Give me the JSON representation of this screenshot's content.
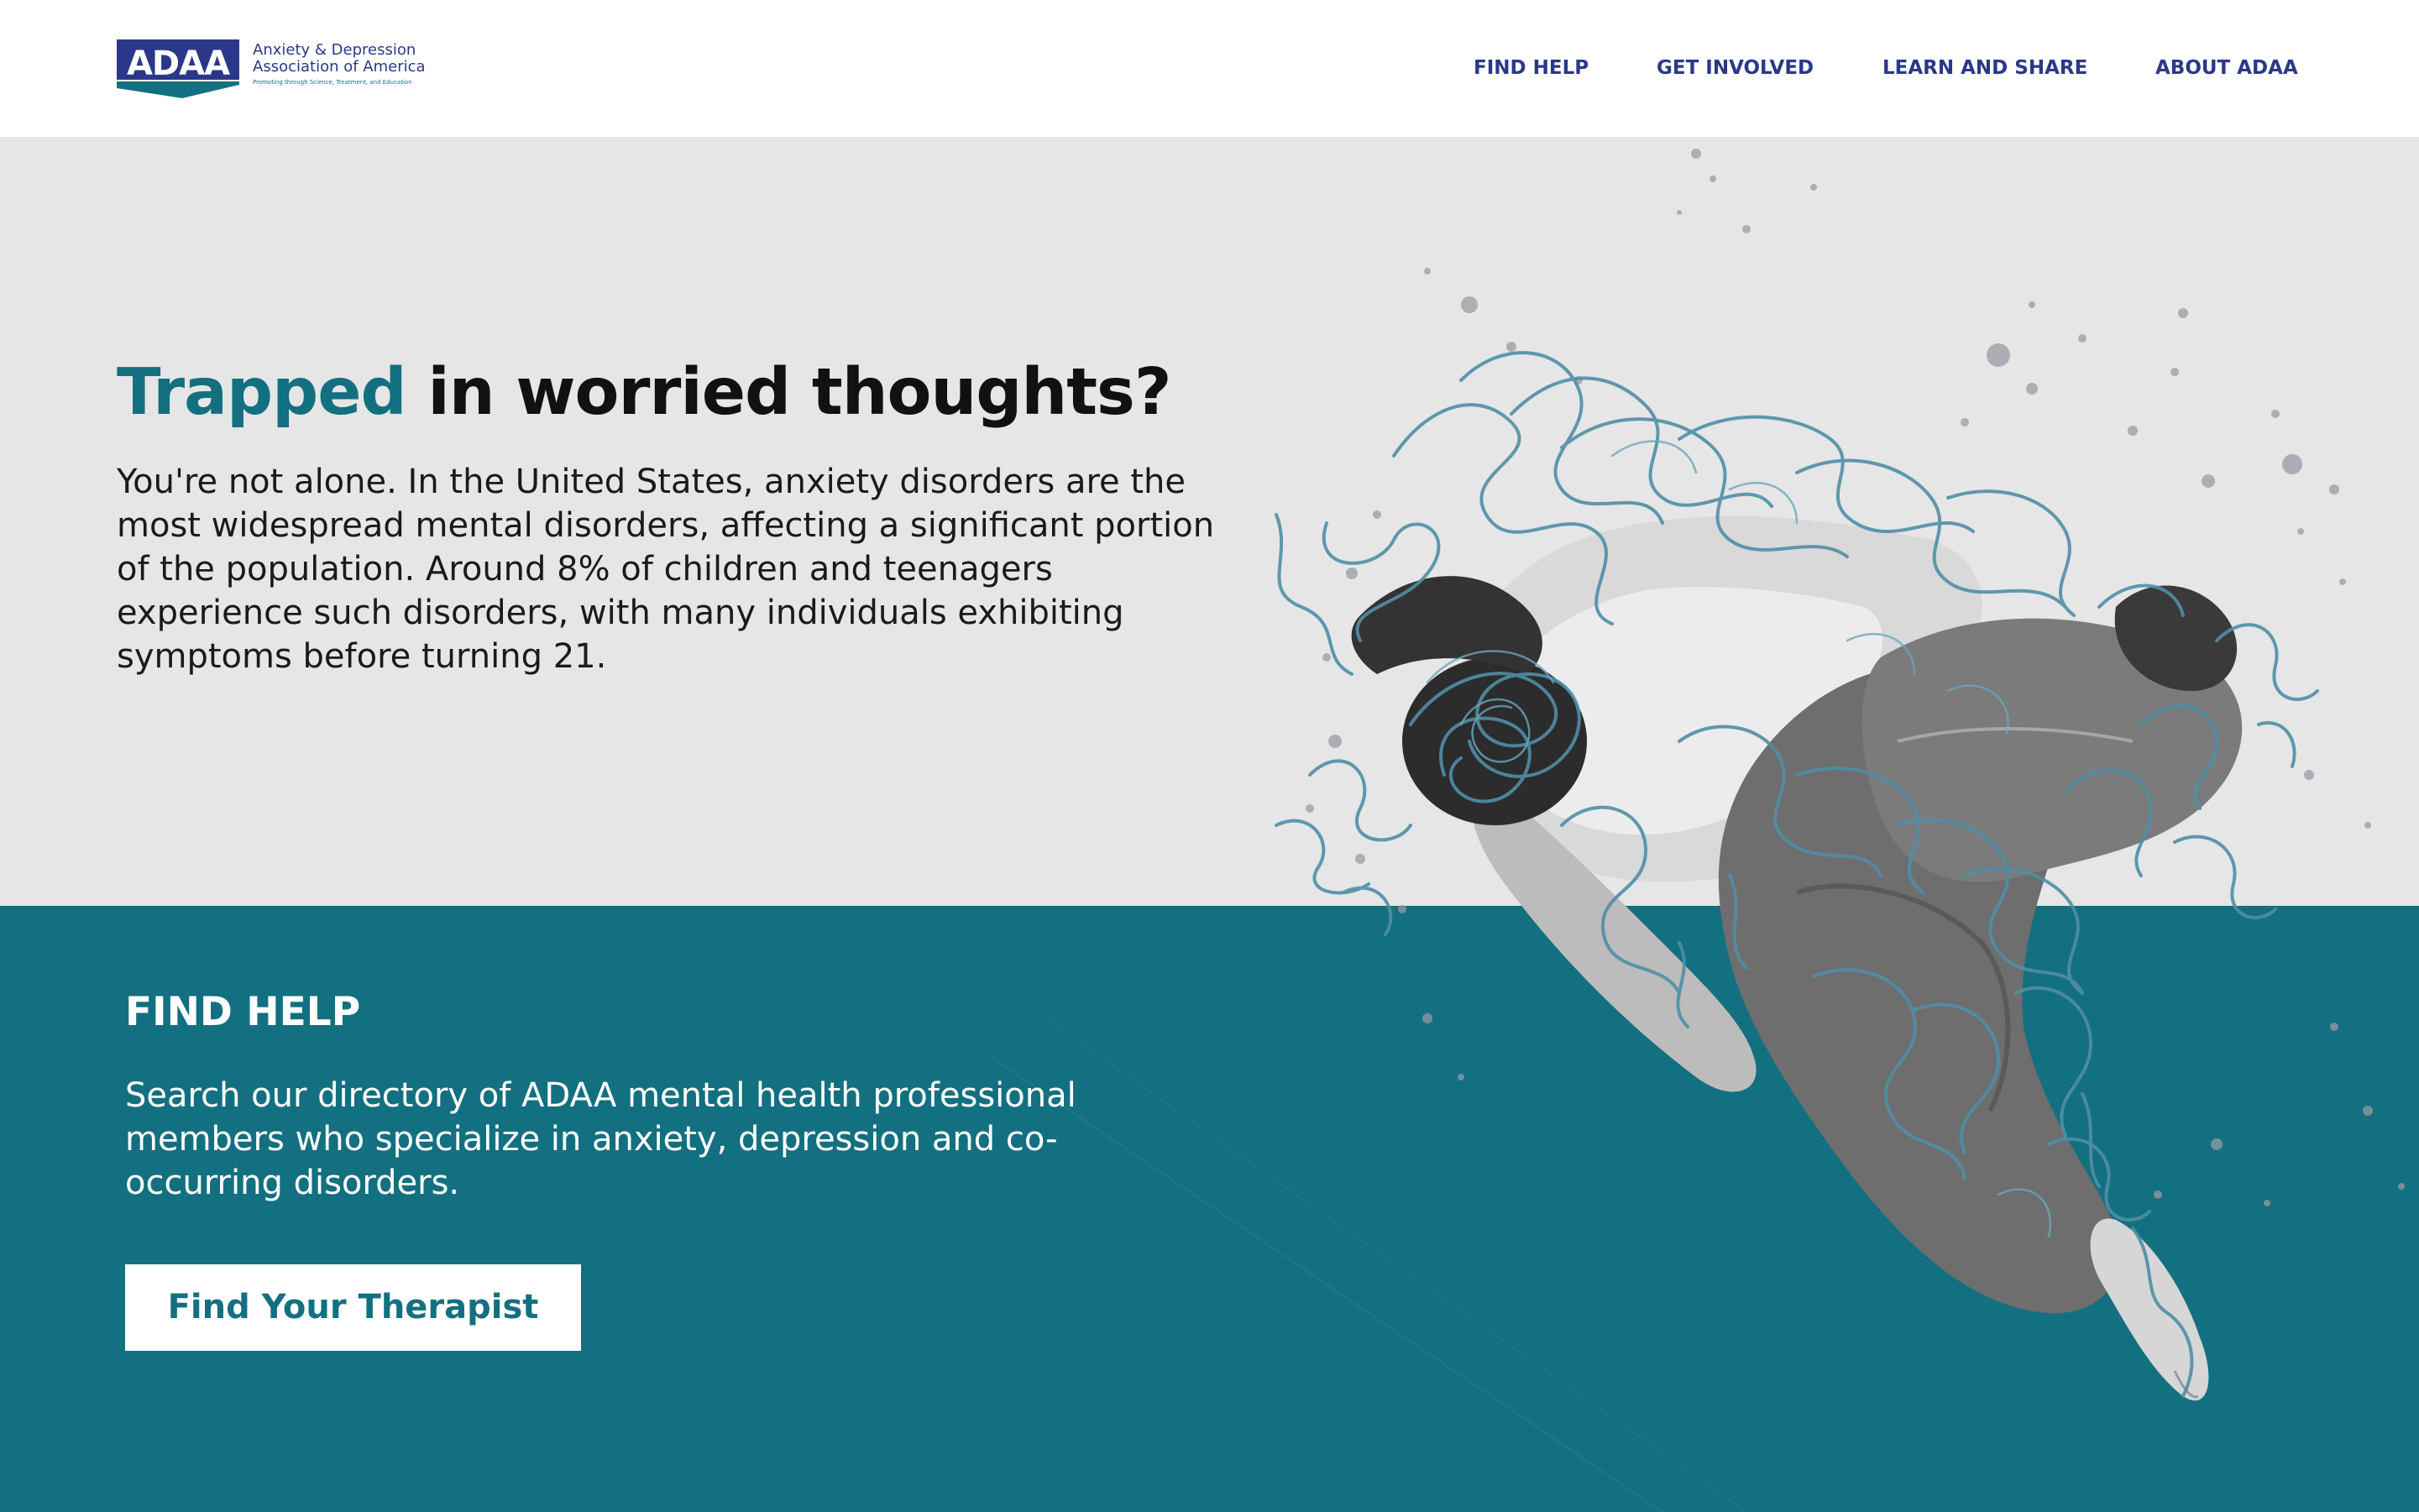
{
  "header": {
    "logo": {
      "abbr": "ADAA",
      "name_line1": "Anxiety & Depression",
      "name_line2": "Association of America",
      "tagline": "Promoting through Science, Treatment, and Education"
    },
    "nav": [
      {
        "label": "FIND HELP"
      },
      {
        "label": "GET INVOLVED"
      },
      {
        "label": "LEARN AND SHARE"
      },
      {
        "label": "ABOUT ADAA"
      }
    ]
  },
  "hero": {
    "headline_accent": "Trapped",
    "headline_rest": " in worried thoughts?",
    "body": "You're not alone. In the United States, anxiety disorders are the most widespread mental disorders, affecting a significant portion of the population. Around 8% of children and teenagers experience such disorders, with many individuals exhibiting symptoms before turning 21."
  },
  "find_help": {
    "title": "FIND HELP",
    "body": "Search our directory of ADAA mental health professional members who specialize in anxiety, depression and co-occurring disorders.",
    "cta_label": "Find Your Therapist"
  },
  "colors": {
    "brand_navy": "#2b3889",
    "brand_teal": "#137080",
    "hero_background": "#e6e6e6",
    "scribble": "#4f8fa6"
  },
  "illustration": {
    "subject": "person-curled-up-with-scribbles-icon"
  }
}
